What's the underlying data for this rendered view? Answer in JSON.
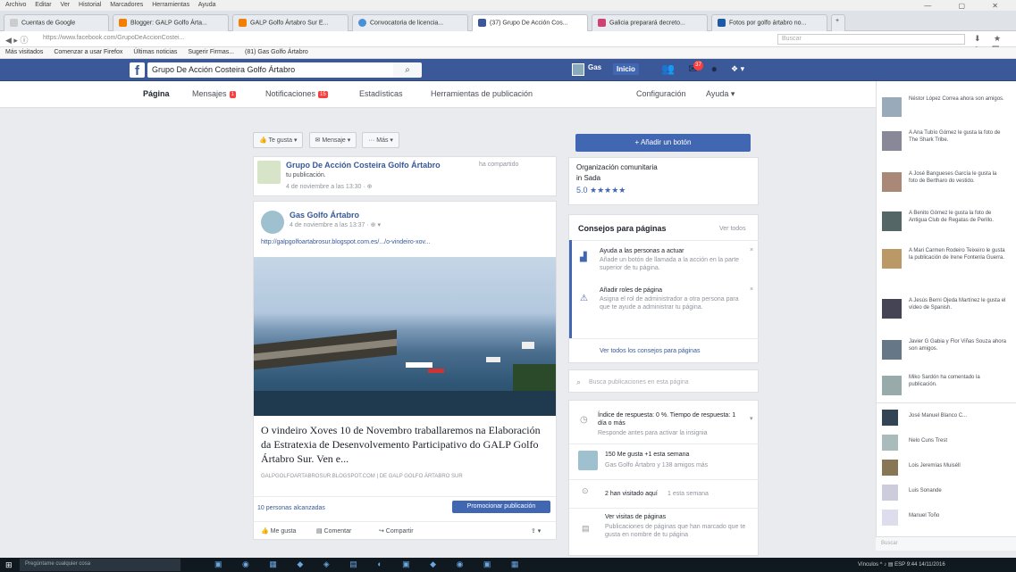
{
  "browser": {
    "menu": [
      "Archivo",
      "Editar",
      "Ver",
      "Historial",
      "Marcadores",
      "Herramientas",
      "Ayuda"
    ],
    "window_controls": "— ▢ ✕",
    "tabs": [
      {
        "label": "Cuentas de Google",
        "color": "#dfe3e8"
      },
      {
        "label": "Blogger: GALP Golfo Árta...",
        "color": "#f57d00"
      },
      {
        "label": "GALP Golfo Ártabro Sur E...",
        "color": "#f57d00"
      },
      {
        "label": "Convocatoria de licencia...",
        "color": "#4a90d9"
      },
      {
        "label": "(37) Grupo De Acción Cos...",
        "color": "#3b5998"
      },
      {
        "label": "Galicia preparará decreto...",
        "color": "#d04070"
      },
      {
        "label": "Fotos por golfo ártabro no...",
        "color": "#1c5aa8"
      }
    ],
    "url": "https://www.facebook.com/GrupoDeAccionCostei...",
    "search_placeholder": "Buscar",
    "nav_icons": "⬇ ★ ⌂ ▤ ♥ ☰",
    "bookmarks": [
      "Más visitados",
      "Comenzar a usar Firefox",
      "Últimas noticias",
      "Sugerir Firmas...",
      "(81) Gas Golfo Ártabro"
    ]
  },
  "fb": {
    "logo": "f",
    "search_value": "Grupo De Acción Costeira Golfo Ártabro",
    "search_icon": "⌕",
    "user": "Gas",
    "home": "Inicio",
    "icons": "👥 ✉ ●",
    "badge": "37",
    "account_icons": "❖ ▾"
  },
  "pagenav": {
    "items": [
      {
        "label": "Página",
        "selected": true
      },
      {
        "label": "Mensajes",
        "badge": "1"
      },
      {
        "label": "Notificaciones",
        "badge": "15"
      },
      {
        "label": "Estadísticas"
      },
      {
        "label": "Herramientas de publicación"
      }
    ],
    "right": [
      "Configuración",
      "Ayuda ▾"
    ]
  },
  "actions": [
    "👍 Te gusta ▾",
    "✉ Mensaje ▾",
    "··· Más ▾"
  ],
  "post1": {
    "name": "Grupo De Acción Costeira Golfo Ártabro",
    "verb": "ha compartido",
    "sub": "tu publicación.",
    "time": "4 de noviembre a las 13:30 · ⊕"
  },
  "post2": {
    "name": "Gas Golfo Ártabro",
    "time": "4 de noviembre a las 13:37 · ⊕ ▾",
    "link": "http://galpgolfoartabrosur.blogspot.com.es/.../o-vindeiro-xov...",
    "title": "O vindeiro Xoves 10 de Novembro traballaremos na Elaboración da Estratexia de Desenvolvemento Participativo do GALP Golfo Ártabro Sur. Ven e...",
    "domain": "GALPGOLFOARTABROSUR.BLOGSPOT.COM | DE GALP GOLFO ÁRTABRO SUR",
    "reach": "10 personas alcanzadas",
    "promote": "Promocionar publicación",
    "reactions": [
      "👍 Me gusta",
      "▤ Comentar",
      "↪ Compartir"
    ],
    "share_icon": "⇪ ▾"
  },
  "middle": {
    "add_button": "+ Añadir un botón",
    "org": "Organización comunitaria",
    "city": "in Sada",
    "rating": "5.0 ★★★★★",
    "tips_title": "Consejos para páginas",
    "tips_see_all": "Ver todos",
    "tip1_title": "Ayuda a las personas a actuar",
    "tip1_body": "Añade un botón de llamada a la acción en la parte superior de tu página.",
    "tip2_title": "Añadir roles de página",
    "tip2_body": "Asigna el rol de administrador a otra persona para que te ayude a administrar tu página.",
    "tips_link": "Ver todos los consejos para páginas",
    "search_placeholder": "Busca publicaciones en esta página",
    "response": "Índice de respuesta: 0 %. Tiempo de respuesta: 1 día o más",
    "response_sub": "Responde antes para activar la insignia",
    "likes": "150 Me gusta +1 esta semana",
    "likes_sub": "Gas Golfo Ártabro y 138 amigos más",
    "views": "2 han visitado aquí",
    "views_extra": "1 esta semana",
    "page_views_title": "Ver visitas de páginas",
    "page_views_sub": "Publicaciones de páginas que han marcado que te gusta en nombre de tu página"
  },
  "ticker": {
    "items": [
      {
        "text": "Néstor López Correa ahora son amigos.",
        "color": "#9ab"
      },
      {
        "text": "A Ana Tubío Gómez le gusta la foto de The Shark Tribe.",
        "color": "#889"
      },
      {
        "text": "A José Bangueses García le gusta la foto de Bertharo do vestido.",
        "color": "#a87"
      },
      {
        "text": "A Benito Gómez le gusta la foto de Antigua Club de Regatas de Perillo.",
        "color": "#566"
      },
      {
        "text": "A Mari Carmen Rodeiro Teixeiro le gusta la publicación de Irene Fontenla Guerra.",
        "color": "#b96"
      },
      {
        "text": "A Jesús Berni Ojeda Martínez le gusta el vídeo de Spanish.",
        "color": "#445"
      },
      {
        "text": "Javier G Gabia y Flor Viñas Souza ahora son amigos.",
        "color": "#678"
      },
      {
        "text": "Miko Sardón ha comentado la publicación.",
        "color": "#9aa"
      }
    ],
    "chat": [
      {
        "name": "José Manuel Blanco C...",
        "color": "#345"
      },
      {
        "name": "Nelo Cuns Trest",
        "color": "#abb"
      },
      {
        "name": "Lois Jeremías Muiséll",
        "color": "#875"
      },
      {
        "name": "Luis Sonande",
        "color": "#ccd"
      },
      {
        "name": "Manuel Toño",
        "color": "#dde"
      }
    ],
    "chat_search": "Buscar"
  },
  "taskbar": {
    "start": "⊞",
    "search": "Pregúntame cualquier cosa",
    "icons": "▣ ◉ ▦ ◆ ◈ ▤ ◐ ▣ ◆ ◉ ▣ ▦",
    "tray": "Vínculos ^ ♪ ▤ ESP  9:44  14/11/2016"
  }
}
